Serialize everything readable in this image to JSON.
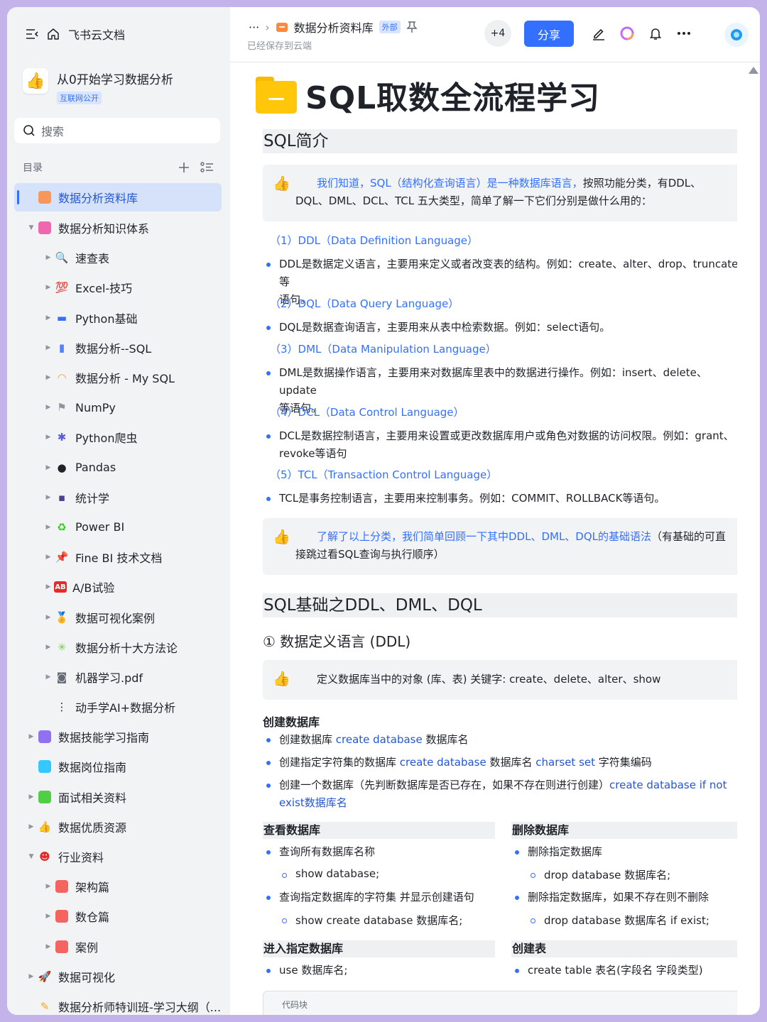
{
  "sidebar": {
    "app_title": "飞书云文档",
    "space": {
      "name": "从0开始学习数据分析",
      "badge": "互联网公开"
    },
    "search_placeholder": "搜索",
    "toc_label": "目录",
    "items": [
      {
        "label": "数据分析资料库",
        "level": 0,
        "caret": "",
        "icon": "library-icon",
        "color": "#ff8a3d",
        "active": true
      },
      {
        "label": "数据分析知识体系",
        "level": 0,
        "caret": "▼",
        "icon": "book-icon",
        "color": "#f04ea2"
      },
      {
        "label": "速查表",
        "level": 1,
        "caret": "▶",
        "icon": "magnifier-icon",
        "color": "#3370ff"
      },
      {
        "label": "Excel-技巧",
        "level": 1,
        "caret": "▶",
        "icon": "hundred-icon",
        "color": "#e22b2b"
      },
      {
        "label": "Python基础",
        "level": 1,
        "caret": "▶",
        "icon": "monitor-icon",
        "color": "#3370ff"
      },
      {
        "label": "数据分析--SQL",
        "level": 1,
        "caret": "▶",
        "icon": "bar-chart-icon",
        "color": "#4e83fd"
      },
      {
        "label": "数据分析 - My SQL",
        "level": 1,
        "caret": "▶",
        "icon": "rainbow-icon",
        "color": "#f5a623"
      },
      {
        "label": "NumPy",
        "level": 1,
        "caret": "▶",
        "icon": "flag-icon",
        "color": "#8f959e"
      },
      {
        "label": "Python爬虫",
        "level": 1,
        "caret": "▶",
        "icon": "spider-icon",
        "color": "#5b5bd6"
      },
      {
        "label": "Pandas",
        "level": 1,
        "caret": "▶",
        "icon": "panda-icon",
        "color": "#1f2329"
      },
      {
        "label": "统计学",
        "level": 1,
        "caret": "▶",
        "icon": "floppy-icon",
        "color": "#4b3f8f"
      },
      {
        "label": "Power BI",
        "level": 1,
        "caret": "▶",
        "icon": "recycle-icon",
        "color": "#34c724"
      },
      {
        "label": "Fine BI 技术文档",
        "level": 1,
        "caret": "▶",
        "icon": "pin-icon",
        "color": "#e22b2b"
      },
      {
        "label": "A/B试验",
        "level": 1,
        "caret": "▶",
        "icon": "ab-icon",
        "color": "#e22b2b"
      },
      {
        "label": "数据可视化案例",
        "level": 1,
        "caret": "▶",
        "icon": "medal-icon",
        "color": "#f5a623"
      },
      {
        "label": "数据分析十大方法论",
        "level": 1,
        "caret": "▶",
        "icon": "sparkle-icon",
        "color": "#7bc950"
      },
      {
        "label": "机器学习.pdf",
        "level": 1,
        "caret": "▶",
        "icon": "robot-icon",
        "color": "#646a73"
      },
      {
        "label": "动手学AI+数据分析",
        "level": 1,
        "caret": "",
        "icon": "traffic-light-icon",
        "color": "#1f2329"
      },
      {
        "label": "数据技能学习指南",
        "level": 0,
        "caret": "▶",
        "icon": "cube-icon",
        "color": "#7f5af0"
      },
      {
        "label": "数据岗位指南",
        "level": 0,
        "caret": "",
        "icon": "location-icon",
        "color": "#14c0ff"
      },
      {
        "label": "面试相关资料",
        "level": 0,
        "caret": "▶",
        "icon": "clock-icon",
        "color": "#34c724"
      },
      {
        "label": "数据优质资源",
        "level": 0,
        "caret": "▶",
        "icon": "thumbs-up-icon",
        "color": "#f5a623"
      },
      {
        "label": "行业资料",
        "level": 0,
        "caret": "▼",
        "icon": "ghost-icon",
        "color": "#e22b2b"
      },
      {
        "label": "架构篇",
        "level": 1,
        "caret": "▶",
        "icon": "doc-icon",
        "color": "#f54a45"
      },
      {
        "label": "数仓篇",
        "level": 1,
        "caret": "▶",
        "icon": "table-icon",
        "color": "#f54a45"
      },
      {
        "label": "案例",
        "level": 1,
        "caret": "▶",
        "icon": "settings-icon",
        "color": "#f54a45"
      },
      {
        "label": "数据可视化",
        "level": 0,
        "caret": "▶",
        "icon": "rocket-icon",
        "color": "#e22b2b"
      },
      {
        "label": "数据分析师特训班-学习大纲（...",
        "level": 0,
        "caret": "",
        "icon": "memo-icon",
        "color": "#f5a623"
      }
    ]
  },
  "topbar": {
    "breadcrumb_more": "···",
    "breadcrumb_sep": "›",
    "doc_name": "数据分析资料库",
    "external_badge": "外部",
    "saved_status": "已经保存到云端",
    "collaborators_more": "+4",
    "share_label": "分享"
  },
  "doc": {
    "title": "SQL取数全流程学习",
    "h_intro": "SQL简介",
    "callout1_blue": "我们知道，SQL（结构化查询语言）是一种数据库语言，",
    "callout1_rest": "按照功能分类，有DDL、",
    "callout1_line2": "DQL、DML、DCL、TCL 五大类型，简单了解一下它们分别是做什么用的：",
    "p1": "（1）DDL（Data Definition Language）",
    "b1a": "DDL是数据定义语言，主要用来定义或者改变表的结构。例如：create、alter、drop、truncate等",
    "b1b": "语句。",
    "p2": "（2）DQL（Data Query Language）",
    "b2": "DQL是数据查询语言，主要用来从表中检索数据。例如：select语句。",
    "p3": "（3）DML（Data Manipulation Language）",
    "b3a": "DML是数据操作语言，主要用来对数据库里表中的数据进行操作。例如：insert、delete、update",
    "b3b": "等语句。",
    "p4": "（4）DCL（Data Control Language）",
    "b4a": "DCL是数据控制语言，主要用来设置或更改数据库用户或角色对数据的访问权限。例如：grant、",
    "b4b": "revoke等语句",
    "p5": "（5）TCL（Transaction Control Language）",
    "b5": "TCL是事务控制语言，主要用来控制事务。例如：COMMIT、ROLLBACK等语句。",
    "callout2_blue": "了解了以上分类，我们简单回顾一下其中DDL、DML、DQL的基础语法",
    "callout2_rest": "（有基础的可直",
    "callout2_line2": "接跳过看SQL查询与执行顺序）",
    "h_basic": "SQL基础之DDL、DML、DQL",
    "h3_ddl": "① 数据定义语言 (DDL)",
    "callout3": "定义数据库当中的对象 (库、表) 关键字: create、delete、alter、show",
    "h4_create_db": "创建数据库",
    "cd1_a": "创建数据库 ",
    "cd1_kw": "create database",
    "cd1_b": " 数据库名",
    "cd2_a": "创建指定字符集的数据库 ",
    "cd2_kw1": "create database",
    "cd2_b": " 数据库名 ",
    "cd2_kw2": "charset set",
    "cd2_c": " 字符集编码",
    "cd3_a": "创建一个数据库（先判断数据库是否已存在，如果不存在则进行创建）",
    "cd3_kw": "create database if not",
    "cd3_line2": "exist数据库名",
    "h4_view_db": "查看数据库",
    "v1": "查询所有数据库名称",
    "v1s": "show database;",
    "v2": "查询指定数据库的字符集 并显示创建语句",
    "v2s": "show create database 数据库名;",
    "h4_drop_db": "删除数据库",
    "d1": "删除指定数据库",
    "d1s": "drop database 数据库名;",
    "d2": "删除指定数据库，如果不存在则不删除",
    "d2s": "drop database 数据库名 if exist;",
    "h4_use_db": "进入指定数据库",
    "u1": "use 数据库名;",
    "h4_create_table": "创建表",
    "t1": "create table 表名(字段名 字段类型)",
    "code_label": "代码块"
  },
  "colors": {
    "accent": "#3370ff",
    "share_bg": "#3370ff",
    "page_bg": "#c4b2ea"
  }
}
